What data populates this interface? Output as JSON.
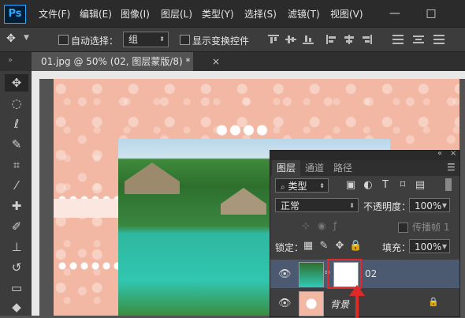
{
  "app": {
    "logo_text": "Ps",
    "accent": "#31a8ff"
  },
  "menu": [
    "文件(F)",
    "编辑(E)",
    "图像(I)",
    "图层(L)",
    "类型(Y)",
    "选择(S)",
    "滤镜(T)",
    "视图(V)"
  ],
  "window_buttons": [
    "—",
    "□"
  ],
  "options_bar": {
    "auto_select_label": "自动选择：",
    "auto_select_value": "组",
    "show_transform_label": "显示变换控件"
  },
  "document_tab": {
    "title": "01.jpg @ 50% (02, 图层蒙版/8) *",
    "close": "×"
  },
  "layers_panel": {
    "tabs": [
      "图层",
      "通道",
      "路径"
    ],
    "topbar": {
      "collapse": "«",
      "close": "×"
    },
    "menu_icon": "☰",
    "filter_value": "类型",
    "blend_mode": "正常",
    "opacity_label": "不透明度：",
    "opacity_value": "100%",
    "propagate_label": "传播帧 1",
    "lock_label": "锁定：",
    "fill_label": "填充：",
    "fill_value": "100%",
    "layers": [
      {
        "name": "02",
        "has_mask": true,
        "selected": true
      },
      {
        "name": "背景",
        "locked": true
      }
    ]
  },
  "colors": {
    "highlight": "#e02a2a",
    "selected_layer": "#4b5a70"
  }
}
